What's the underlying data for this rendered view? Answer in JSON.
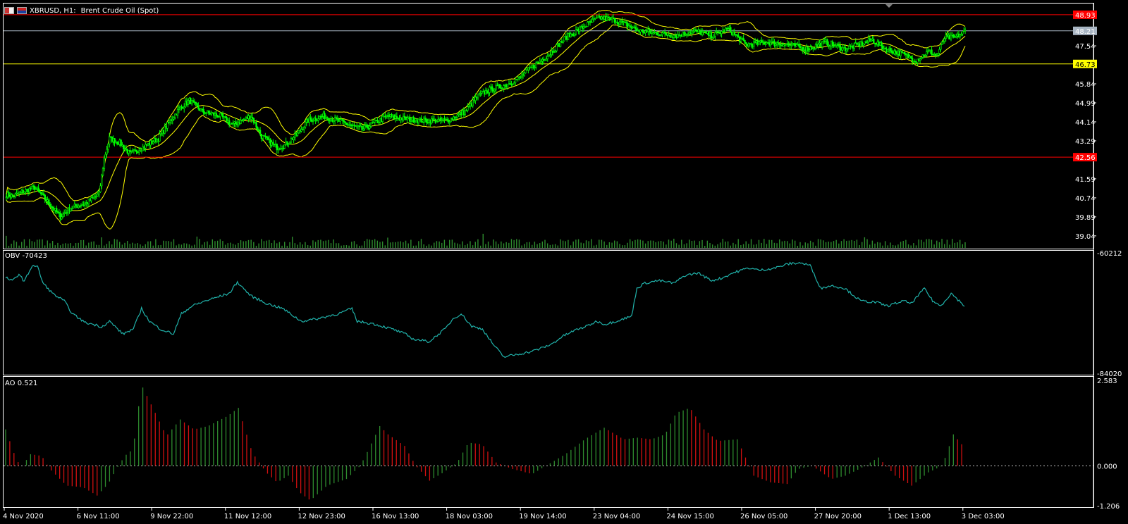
{
  "header": {
    "symbol": "XBRUSD, H1:",
    "name": "Brent Crude Oil (Spot)"
  },
  "colors": {
    "background": "#000000",
    "grid_border": "#ffffff",
    "candle": "#00ff00",
    "bollinger": "#ffff00",
    "resistance": "#ff0000",
    "support": "#ffff00",
    "current_price": "#a9b6c4",
    "volume": "#2e8b2e",
    "obv": "#20b2aa",
    "ao_up": "#2e8b2e",
    "ao_down": "#d01010"
  },
  "price_panel": {
    "y_ticks": [
      "39.04",
      "39.89",
      "40.74",
      "41.59",
      "43.29",
      "44.14",
      "44.99",
      "45.84",
      "47.54"
    ],
    "tags": [
      {
        "label": "48.93",
        "value": 48.93,
        "color": "#ff0000",
        "text_color": "#ffffff"
      },
      {
        "label": "48.21",
        "value": 48.21,
        "color": "#a9b6c4",
        "text_color": "#ffffff"
      },
      {
        "label": "46.73",
        "value": 46.73,
        "color": "#ffff00",
        "text_color": "#000000"
      },
      {
        "label": "42.56",
        "value": 42.56,
        "color": "#ff0000",
        "text_color": "#ffffff"
      }
    ]
  },
  "obv_panel": {
    "label": "OBV -70423",
    "y_max_label": "-60212",
    "y_min_label": "-84020"
  },
  "ao_panel": {
    "label": "AO 0.521",
    "y_ticks": [
      "2.583",
      "0.000",
      "-1.206"
    ]
  },
  "x_axis": {
    "labels": [
      "4 Nov 2020",
      "6 Nov 11:00",
      "9 Nov 22:00",
      "11 Nov 12:00",
      "12 Nov 23:00",
      "16 Nov 13:00",
      "18 Nov 03:00",
      "19 Nov 14:00",
      "23 Nov 04:00",
      "24 Nov 15:00",
      "26 Nov 05:00",
      "27 Nov 20:00",
      "1 Dec 13:00",
      "3 Dec 03:00"
    ]
  },
  "chart_data": [
    {
      "type": "candlestick",
      "title": "XBRUSD, H1: Brent Crude Oil (Spot)",
      "ylim": [
        38.5,
        49.4
      ],
      "anchors": [
        [
          0,
          40.9
        ],
        [
          5,
          40.8
        ],
        [
          12,
          41.0
        ],
        [
          22,
          41.2
        ],
        [
          30,
          40.7
        ],
        [
          42,
          39.9
        ],
        [
          50,
          40.3
        ],
        [
          62,
          40.5
        ],
        [
          72,
          40.9
        ],
        [
          76,
          42.5
        ],
        [
          80,
          43.4
        ],
        [
          88,
          43.2
        ],
        [
          96,
          42.7
        ],
        [
          106,
          43.0
        ],
        [
          118,
          43.4
        ],
        [
          126,
          44.1
        ],
        [
          134,
          44.7
        ],
        [
          142,
          45.1
        ],
        [
          152,
          44.6
        ],
        [
          166,
          44.4
        ],
        [
          176,
          44.0
        ],
        [
          190,
          44.4
        ],
        [
          198,
          43.5
        ],
        [
          210,
          43.0
        ],
        [
          216,
          43.1
        ],
        [
          226,
          43.6
        ],
        [
          234,
          44.2
        ],
        [
          246,
          44.4
        ],
        [
          262,
          44.1
        ],
        [
          276,
          43.8
        ],
        [
          286,
          44.1
        ],
        [
          296,
          44.4
        ],
        [
          306,
          44.3
        ],
        [
          322,
          44.2
        ],
        [
          342,
          44.2
        ],
        [
          356,
          44.6
        ],
        [
          366,
          45.3
        ],
        [
          376,
          45.6
        ],
        [
          388,
          45.8
        ],
        [
          398,
          46.1
        ],
        [
          408,
          46.6
        ],
        [
          420,
          47.1
        ],
        [
          434,
          47.9
        ],
        [
          448,
          48.4
        ],
        [
          460,
          48.8
        ],
        [
          472,
          48.7
        ],
        [
          484,
          48.4
        ],
        [
          492,
          48.2
        ],
        [
          506,
          48.1
        ],
        [
          520,
          48.0
        ],
        [
          534,
          48.2
        ],
        [
          548,
          48.0
        ],
        [
          560,
          48.3
        ],
        [
          574,
          47.6
        ],
        [
          590,
          47.7
        ],
        [
          606,
          47.6
        ],
        [
          622,
          47.4
        ],
        [
          636,
          47.7
        ],
        [
          650,
          47.4
        ],
        [
          662,
          47.6
        ],
        [
          672,
          47.8
        ],
        [
          682,
          47.4
        ],
        [
          694,
          47.2
        ],
        [
          706,
          46.9
        ],
        [
          716,
          47.3
        ],
        [
          722,
          47.1
        ],
        [
          728,
          47.9
        ],
        [
          736,
          47.9
        ],
        [
          744,
          48.2
        ]
      ],
      "volume_range": [
        200,
        3500
      ]
    },
    {
      "type": "line",
      "title": "OBV -70423",
      "ylim": [
        -84020,
        -60212
      ],
      "anchors": [
        [
          0,
          -65200
        ],
        [
          5,
          -65900
        ],
        [
          10,
          -64500
        ],
        [
          14,
          -66000
        ],
        [
          20,
          -62800
        ],
        [
          24,
          -63100
        ],
        [
          28,
          -66300
        ],
        [
          36,
          -68500
        ],
        [
          44,
          -69800
        ],
        [
          50,
          -72300
        ],
        [
          60,
          -74100
        ],
        [
          66,
          -74400
        ],
        [
          72,
          -74900
        ],
        [
          78,
          -73800
        ],
        [
          88,
          -76300
        ],
        [
          96,
          -75300
        ],
        [
          102,
          -71300
        ],
        [
          108,
          -73800
        ],
        [
          116,
          -75300
        ],
        [
          126,
          -76300
        ],
        [
          132,
          -72300
        ],
        [
          140,
          -70800
        ],
        [
          150,
          -69800
        ],
        [
          156,
          -69300
        ],
        [
          168,
          -68300
        ],
        [
          174,
          -66100
        ],
        [
          184,
          -68800
        ],
        [
          196,
          -70300
        ],
        [
          208,
          -71300
        ],
        [
          222,
          -73800
        ],
        [
          234,
          -73300
        ],
        [
          250,
          -72300
        ],
        [
          260,
          -71300
        ],
        [
          264,
          -73800
        ],
        [
          276,
          -74300
        ],
        [
          290,
          -75300
        ],
        [
          300,
          -76300
        ],
        [
          306,
          -77300
        ],
        [
          318,
          -77800
        ],
        [
          330,
          -75300
        ],
        [
          336,
          -73300
        ],
        [
          342,
          -72300
        ],
        [
          350,
          -74800
        ],
        [
          358,
          -75300
        ],
        [
          366,
          -78300
        ],
        [
          374,
          -80800
        ],
        [
          380,
          -80500
        ],
        [
          394,
          -79800
        ],
        [
          400,
          -79300
        ],
        [
          410,
          -78300
        ],
        [
          418,
          -76800
        ],
        [
          428,
          -75500
        ],
        [
          436,
          -74800
        ],
        [
          444,
          -73800
        ],
        [
          450,
          -74400
        ],
        [
          458,
          -73800
        ],
        [
          464,
          -73300
        ],
        [
          470,
          -72800
        ],
        [
          474,
          -67300
        ],
        [
          480,
          -66300
        ],
        [
          490,
          -65800
        ],
        [
          502,
          -66300
        ],
        [
          510,
          -64800
        ],
        [
          520,
          -64300
        ],
        [
          530,
          -65800
        ],
        [
          538,
          -65300
        ],
        [
          546,
          -64300
        ],
        [
          558,
          -63300
        ],
        [
          566,
          -63800
        ],
        [
          578,
          -63300
        ],
        [
          588,
          -62500
        ],
        [
          596,
          -62300
        ],
        [
          604,
          -62800
        ],
        [
          612,
          -67300
        ],
        [
          620,
          -66800
        ],
        [
          630,
          -67300
        ],
        [
          642,
          -69800
        ],
        [
          654,
          -70100
        ],
        [
          662,
          -70800
        ],
        [
          674,
          -69800
        ],
        [
          680,
          -70300
        ],
        [
          690,
          -67300
        ],
        [
          696,
          -69800
        ],
        [
          702,
          -70800
        ],
        [
          710,
          -68300
        ],
        [
          720,
          -70800
        ]
      ]
    },
    {
      "type": "bar",
      "title": "AO 0.521",
      "ylim": [
        -1.206,
        2.583
      ],
      "anchors": [
        [
          0,
          1.1
        ],
        [
          8,
          0.15
        ],
        [
          12,
          0.0
        ],
        [
          18,
          0.35
        ],
        [
          26,
          0.3
        ],
        [
          32,
          -0.1
        ],
        [
          44,
          -0.6
        ],
        [
          56,
          -0.65
        ],
        [
          66,
          -0.9
        ],
        [
          74,
          -0.55
        ],
        [
          80,
          -0.1
        ],
        [
          86,
          0.3
        ],
        [
          92,
          0.5
        ],
        [
          98,
          2.45
        ],
        [
          108,
          1.6
        ],
        [
          116,
          0.9
        ],
        [
          126,
          1.4
        ],
        [
          136,
          1.1
        ],
        [
          146,
          1.2
        ],
        [
          160,
          1.5
        ],
        [
          168,
          1.75
        ],
        [
          178,
          0.4
        ],
        [
          188,
          -0.2
        ],
        [
          196,
          -0.5
        ],
        [
          204,
          -0.3
        ],
        [
          212,
          -0.8
        ],
        [
          220,
          -1.05
        ],
        [
          232,
          -0.6
        ],
        [
          246,
          -0.4
        ],
        [
          256,
          0.0
        ],
        [
          262,
          0.5
        ],
        [
          270,
          1.2
        ],
        [
          276,
          0.95
        ],
        [
          288,
          0.6
        ],
        [
          296,
          0.0
        ],
        [
          306,
          -0.45
        ],
        [
          316,
          -0.2
        ],
        [
          326,
          0.1
        ],
        [
          334,
          0.7
        ],
        [
          344,
          0.65
        ],
        [
          354,
          0.1
        ],
        [
          366,
          -0.1
        ],
        [
          380,
          -0.25
        ],
        [
          390,
          0.0
        ],
        [
          404,
          0.35
        ],
        [
          418,
          0.8
        ],
        [
          432,
          1.15
        ],
        [
          446,
          0.8
        ],
        [
          456,
          0.85
        ],
        [
          466,
          0.8
        ],
        [
          476,
          0.95
        ],
        [
          484,
          1.6
        ],
        [
          494,
          1.75
        ],
        [
          504,
          1.1
        ],
        [
          514,
          0.75
        ],
        [
          528,
          0.8
        ],
        [
          540,
          -0.3
        ],
        [
          552,
          -0.5
        ],
        [
          564,
          -0.55
        ],
        [
          572,
          -0.1
        ],
        [
          582,
          0.0
        ],
        [
          596,
          -0.4
        ],
        [
          606,
          -0.3
        ],
        [
          616,
          -0.1
        ],
        [
          630,
          0.25
        ],
        [
          642,
          -0.3
        ],
        [
          654,
          -0.6
        ],
        [
          666,
          -0.2
        ],
        [
          676,
          0.0
        ],
        [
          684,
          0.95
        ],
        [
          692,
          0.55
        ]
      ]
    }
  ]
}
